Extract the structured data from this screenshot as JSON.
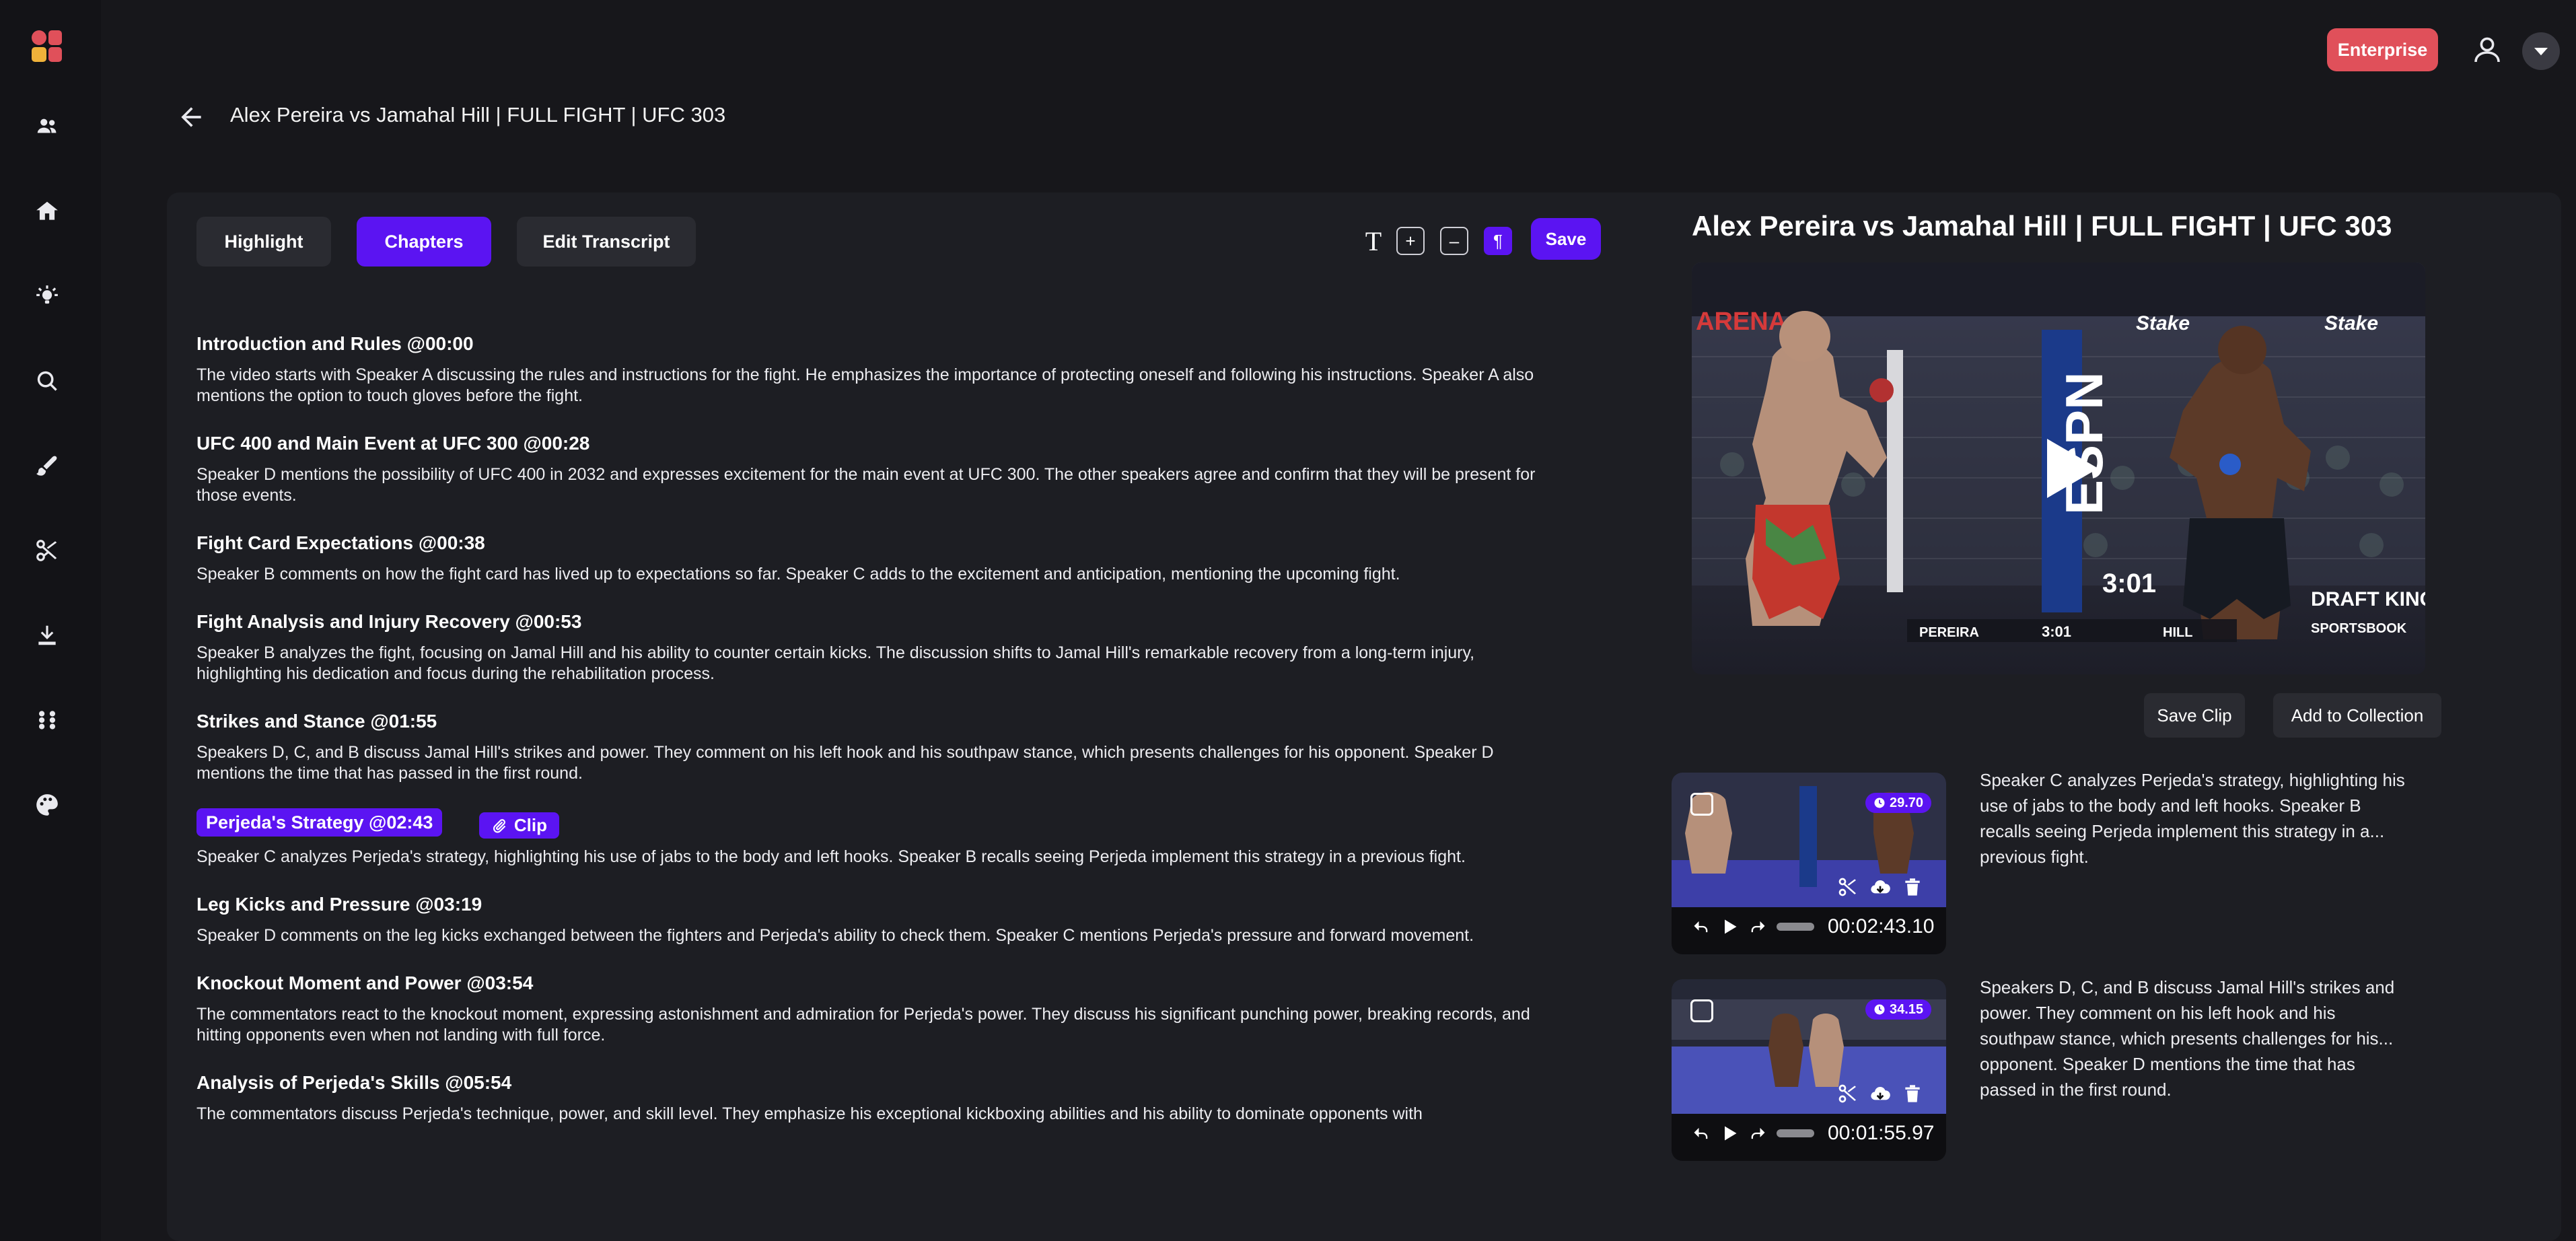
{
  "header": {
    "page_title": "Alex Pereira vs Jamahal Hill | FULL FIGHT | UFC 303",
    "enterprise_label": "Enterprise"
  },
  "sidebar": {
    "items": [
      {
        "icon": "users-icon"
      },
      {
        "icon": "home-icon"
      },
      {
        "icon": "lightbulb-icon"
      },
      {
        "icon": "search-icon"
      },
      {
        "icon": "brush-icon"
      },
      {
        "icon": "scissors-icon"
      },
      {
        "icon": "download-icon"
      },
      {
        "icon": "sliders-icon"
      },
      {
        "icon": "palette-icon"
      }
    ]
  },
  "tabs": [
    {
      "label": "Highlight",
      "active": false
    },
    {
      "label": "Chapters",
      "active": true
    },
    {
      "label": "Edit Transcript",
      "active": false
    }
  ],
  "toolbar": {
    "text_icon_glyph": "T",
    "plus_glyph": "+",
    "minus_glyph": "–",
    "paragraph_glyph": "¶",
    "save_label": "Save"
  },
  "chapters": [
    {
      "title": "Introduction and Rules @00:00",
      "desc": "The video starts with Speaker A discussing the rules and instructions for the fight. He emphasizes the importance of protecting oneself and following his instructions. Speaker A also mentions the option to touch gloves before the fight."
    },
    {
      "title": "UFC 400 and Main Event at UFC 300 @00:28",
      "desc": "Speaker D mentions the possibility of UFC 400 in 2032 and expresses excitement for the main event at UFC 300. The other speakers agree and confirm that they will be present for those events."
    },
    {
      "title": "Fight Card Expectations @00:38",
      "desc": "Speaker B comments on how the fight card has lived up to expectations so far. Speaker C adds to the excitement and anticipation, mentioning the upcoming fight."
    },
    {
      "title": "Fight Analysis and Injury Recovery @00:53",
      "desc": "Speaker B analyzes the fight, focusing on Jamal Hill and his ability to counter certain kicks. The discussion shifts to Jamal Hill's remarkable recovery from a long-term injury, highlighting his dedication and focus during the rehabilitation process."
    },
    {
      "title": "Strikes and Stance @01:55",
      "desc": "Speakers D, C, and B discuss Jamal Hill's strikes and power. They comment on his left hook and his southpaw stance, which presents challenges for his opponent. Speaker D mentions the time that has passed in the first round."
    },
    {
      "title": "Perjeda's Strategy @02:43",
      "desc": "Speaker C analyzes Perjeda's strategy, highlighting his use of jabs to the body and left hooks. Speaker B recalls seeing Perjeda implement this strategy in a previous fight.",
      "highlighted": true,
      "clip_label": "Clip"
    },
    {
      "title": "Leg Kicks and Pressure @03:19",
      "desc": "Speaker D comments on the leg kicks exchanged between the fighters and Perjeda's ability to check them. Speaker C mentions Perjeda's pressure and forward movement."
    },
    {
      "title": "Knockout Moment and Power @03:54",
      "desc": "The commentators react to the knockout moment, expressing astonishment and admiration for Perjeda's power. They discuss his significant punching power, breaking records, and hitting opponents even when not landing with full force."
    },
    {
      "title": "Analysis of Perjeda's Skills @05:54",
      "desc": "The commentators discuss Perjeda's technique, power, and skill level. They emphasize his exceptional kickboxing abilities and his ability to dominate opponents with"
    }
  ],
  "video": {
    "title": "Alex Pereira vs Jamahal Hill | FULL FIGHT | UFC 303",
    "scoreboard": {
      "fighter1": "PEREIRA",
      "fighter2": "HILL",
      "round": "3:01",
      "clock": "3:01"
    },
    "overlay_texts": {
      "espn": "ESPN",
      "arena": "ARENA",
      "stake": "Stake",
      "draftkings": "DRAFT KINGS",
      "sportsbook": "SPORTSBOOK"
    },
    "save_clip_label": "Save Clip",
    "add_collection_label": "Add to Collection"
  },
  "clips": [
    {
      "badge": "29.70",
      "time": "00:02:43.10",
      "summary_lines": [
        "Speaker C analyzes Perjeda's strategy, highlighting his",
        "use of jabs to the body and left hooks. Speaker B",
        "recalls seeing Perjeda implement this strategy in a...",
        "previous fight."
      ]
    },
    {
      "badge": "34.15",
      "time": "00:01:55.97",
      "summary_lines": [
        "Speakers D, C, and B discuss Jamal Hill's strikes and",
        "power. They comment on his left hook and his",
        "southpaw stance, which presents challenges for his...",
        "opponent. Speaker D mentions the time that has",
        "passed in the first round."
      ]
    }
  ],
  "colors": {
    "accent": "#5b14f2",
    "enterprise": "#e0505a",
    "background": "#17171b",
    "panel": "#1d1e23"
  }
}
